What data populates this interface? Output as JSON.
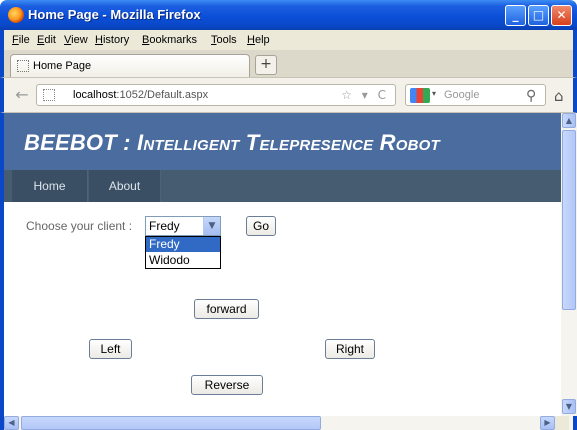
{
  "window": {
    "title": "Home Page - Mozilla Firefox",
    "controls": {
      "minimize": "_",
      "maximize": "□",
      "close": "✕"
    }
  },
  "menu": {
    "items": [
      "File",
      "Edit",
      "View",
      "History",
      "Bookmarks",
      "Tools",
      "Help"
    ]
  },
  "tabs": {
    "items": [
      {
        "label": "Home Page"
      }
    ],
    "new_tab": "+"
  },
  "nav": {
    "back": "←",
    "url_host": "localhost",
    "url_rest": ":1052/Default.aspx",
    "url_icons": "☆ ▾ C",
    "search_caret": "▾",
    "search_placeholder": "Google",
    "search_icon": "⚲",
    "home_icon": "⌂"
  },
  "site": {
    "title": "BEEBOT : Intelligent Telepresence Robot",
    "menu": [
      "Home",
      "About"
    ]
  },
  "form": {
    "client_label": "Choose your client :",
    "selected_client": "Fredy",
    "select_arrow": "▼",
    "options": [
      "Fredy",
      "Widodo"
    ],
    "go_button": "Go"
  },
  "controls": {
    "forward": "forward",
    "left": "Left",
    "right": "Right",
    "reverse": "Reverse"
  },
  "scroll": {
    "up": "▲",
    "down": "▼",
    "left": "◀",
    "right": "▶"
  },
  "colors": {
    "titlebar": "#0a48c8",
    "site_header": "#4b6c9e",
    "site_nav": "#465c71",
    "option_highlight": "#316ac5"
  }
}
